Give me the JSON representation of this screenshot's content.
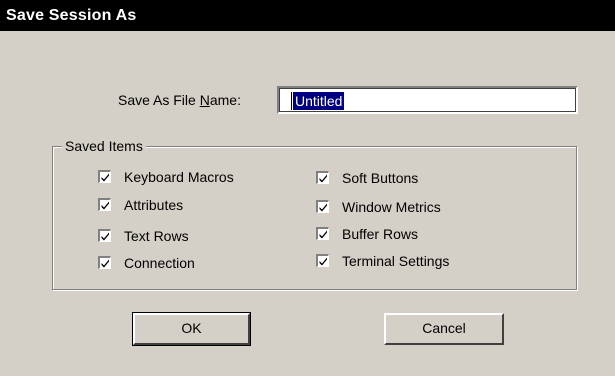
{
  "dialog": {
    "title": "Save Session As",
    "filename": {
      "label_pre": "Save As File ",
      "label_mnemonic": "N",
      "label_post": "ame:",
      "value": "Untitled"
    },
    "group": {
      "title": "Saved Items",
      "items_left": [
        {
          "label": "Keyboard Macros",
          "checked": true
        },
        {
          "label": "Attributes",
          "checked": true
        },
        {
          "label": "Text Rows",
          "checked": true
        },
        {
          "label": "Connection",
          "checked": true
        }
      ],
      "items_right": [
        {
          "label": "Soft Buttons",
          "checked": true
        },
        {
          "label": "Window Metrics",
          "checked": true
        },
        {
          "label": "Buffer Rows",
          "checked": true
        },
        {
          "label": "Terminal Settings",
          "checked": true
        }
      ]
    },
    "buttons": {
      "ok": "OK",
      "cancel": "Cancel"
    }
  }
}
